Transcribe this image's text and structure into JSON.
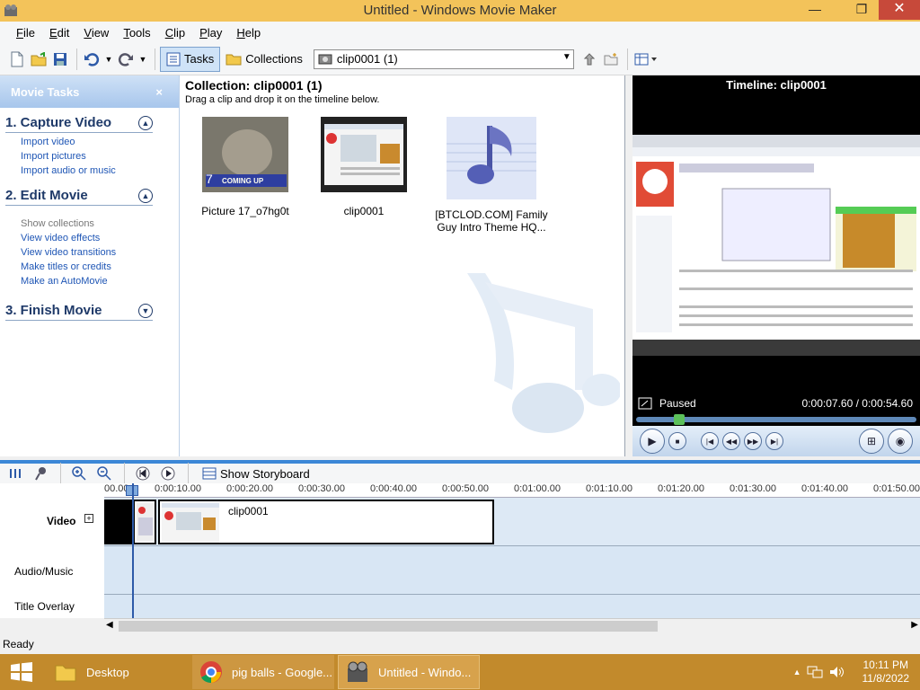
{
  "window": {
    "title": "Untitled - Windows Movie Maker",
    "minimize": "—",
    "restore": "❐",
    "close": "✕"
  },
  "menu": [
    "File",
    "Edit",
    "View",
    "Tools",
    "Clip",
    "Play",
    "Help"
  ],
  "toolbar": {
    "tasks_label": "Tasks",
    "collections_label": "Collections",
    "collection_select": "clip0001 (1)"
  },
  "taskpane": {
    "title": "Movie Tasks",
    "close": "×",
    "sections": [
      {
        "title": "1. Capture Video",
        "links": [
          "Import video",
          "Import pictures",
          "Import audio or music"
        ]
      },
      {
        "title": "2. Edit Movie",
        "links": [
          "Show collections",
          "View video effects",
          "View video transitions",
          "Make titles or credits",
          "Make an AutoMovie"
        ]
      },
      {
        "title": "3. Finish Movie",
        "links": []
      }
    ]
  },
  "collection": {
    "title": "Collection: clip0001 (1)",
    "subtitle": "Drag a clip and drop it on the timeline below.",
    "items": [
      {
        "name": "Picture 17_o7hg0t",
        "overlay": "COMING UP"
      },
      {
        "name": "clip0001"
      },
      {
        "name": "[BTCLOD.COM] Family Guy Intro Theme HQ..."
      }
    ]
  },
  "preview": {
    "title": "Timeline: clip0001",
    "status": "Paused",
    "time": "0:00:07.60 / 0:00:54.60",
    "position": 0.139
  },
  "timeline": {
    "show_storyboard": "Show Storyboard",
    "ruler": [
      "00.00",
      "0:00:10.00",
      "0:00:20.00",
      "0:00:30.00",
      "0:00:40.00",
      "0:00:50.00",
      "0:01:00.00",
      "0:01:10.00",
      "0:01:20.00",
      "0:01:30.00",
      "0:01:40.00",
      "0:01:50.00"
    ],
    "tracks": [
      "Video",
      "Audio/Music",
      "Title Overlay"
    ],
    "clip_label": "clip0001"
  },
  "statusbar": {
    "text": "Ready"
  },
  "taskbar": {
    "tasks": [
      "Desktop",
      "pig balls - Google...",
      "Untitled - Windo..."
    ],
    "clock_time": "10:11 PM",
    "clock_date": "11/8/2022"
  },
  "colors": {
    "titlebar": "#f3c35a",
    "taskbar": "#c28a2c",
    "accent": "#3b87d7"
  }
}
